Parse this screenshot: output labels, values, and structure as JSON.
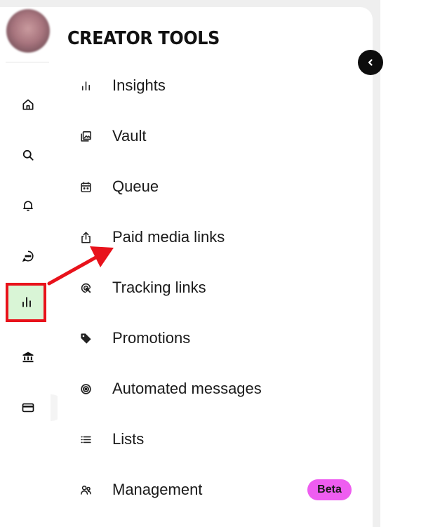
{
  "sidebar": {
    "rail_icons": [
      {
        "icon": "home-icon",
        "active": false
      },
      {
        "icon": "search-icon",
        "active": false
      },
      {
        "icon": "bell-icon",
        "active": false
      },
      {
        "icon": "chat-icon",
        "active": false
      },
      {
        "icon": "insights-icon",
        "active": true
      },
      {
        "icon": "bank-icon",
        "active": false
      },
      {
        "icon": "card-icon",
        "active": false
      }
    ]
  },
  "menu": {
    "title": "CREATOR TOOLS",
    "items": [
      {
        "label": "Insights",
        "icon": "bar-chart-icon"
      },
      {
        "label": "Vault",
        "icon": "gallery-icon"
      },
      {
        "label": "Queue",
        "icon": "calendar-icon"
      },
      {
        "label": "Paid media links",
        "icon": "share-icon"
      },
      {
        "label": "Tracking links",
        "icon": "tracking-icon"
      },
      {
        "label": "Promotions",
        "icon": "tag-icon"
      },
      {
        "label": "Automated messages",
        "icon": "automation-icon"
      },
      {
        "label": "Lists",
        "icon": "list-icon"
      },
      {
        "label": "Management",
        "icon": "people-icon"
      }
    ],
    "management_badge": "Beta"
  },
  "colors": {
    "active_bg": "#d9f5d6",
    "highlight": "#e8121b",
    "badge": "#ee5df0",
    "annotation_arrow": "#e8121b"
  }
}
